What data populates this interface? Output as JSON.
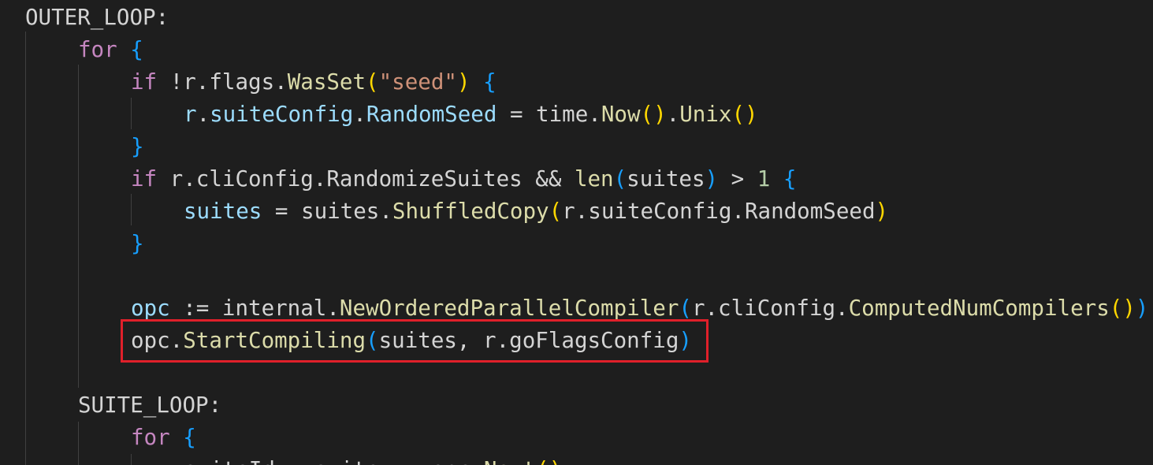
{
  "editor": {
    "background": "#1e1e1e",
    "highlight_color": "#e0202a",
    "highlighted_line": 10,
    "lines": [
      {
        "indent": 0,
        "tokens": [
          {
            "t": "OUTER_LOOP:",
            "c": "plain"
          }
        ]
      },
      {
        "indent": 1,
        "tokens": [
          {
            "t": "for",
            "c": "kw-ctrl"
          },
          {
            "t": " ",
            "c": "plain"
          },
          {
            "t": "{",
            "c": "b3"
          }
        ]
      },
      {
        "indent": 2,
        "tokens": [
          {
            "t": "if",
            "c": "kw-ctrl"
          },
          {
            "t": " !r.flags.",
            "c": "plain"
          },
          {
            "t": "WasSet",
            "c": "fn"
          },
          {
            "t": "(",
            "c": "b1"
          },
          {
            "t": "\"seed\"",
            "c": "str"
          },
          {
            "t": ")",
            "c": "b1"
          },
          {
            "t": " ",
            "c": "plain"
          },
          {
            "t": "{",
            "c": "b3"
          }
        ]
      },
      {
        "indent": 3,
        "tokens": [
          {
            "t": "r",
            "c": "var"
          },
          {
            "t": ".",
            "c": "plain"
          },
          {
            "t": "suiteConfig",
            "c": "var"
          },
          {
            "t": ".",
            "c": "plain"
          },
          {
            "t": "RandomSeed",
            "c": "var"
          },
          {
            "t": " = time.",
            "c": "plain"
          },
          {
            "t": "Now",
            "c": "fn"
          },
          {
            "t": "()",
            "c": "b1"
          },
          {
            "t": ".",
            "c": "plain"
          },
          {
            "t": "Unix",
            "c": "fn"
          },
          {
            "t": "()",
            "c": "b1"
          }
        ]
      },
      {
        "indent": 2,
        "tokens": [
          {
            "t": "}",
            "c": "b3"
          }
        ]
      },
      {
        "indent": 2,
        "tokens": [
          {
            "t": "if",
            "c": "kw-ctrl"
          },
          {
            "t": " r.cliConfig.RandomizeSuites && ",
            "c": "plain"
          },
          {
            "t": "len",
            "c": "fn"
          },
          {
            "t": "(",
            "c": "b3"
          },
          {
            "t": "suites",
            "c": "plain"
          },
          {
            "t": ")",
            "c": "b3"
          },
          {
            "t": " > ",
            "c": "plain"
          },
          {
            "t": "1",
            "c": "num"
          },
          {
            "t": " ",
            "c": "plain"
          },
          {
            "t": "{",
            "c": "b3"
          }
        ]
      },
      {
        "indent": 3,
        "tokens": [
          {
            "t": "suites",
            "c": "var"
          },
          {
            "t": " = suites.",
            "c": "plain"
          },
          {
            "t": "ShuffledCopy",
            "c": "fn"
          },
          {
            "t": "(",
            "c": "b1"
          },
          {
            "t": "r.suiteConfig.RandomSeed",
            "c": "plain"
          },
          {
            "t": ")",
            "c": "b1"
          }
        ]
      },
      {
        "indent": 2,
        "tokens": [
          {
            "t": "}",
            "c": "b3"
          }
        ]
      },
      {
        "indent": 2,
        "tokens": []
      },
      {
        "indent": 2,
        "tokens": [
          {
            "t": "opc",
            "c": "var"
          },
          {
            "t": " := internal.",
            "c": "plain"
          },
          {
            "t": "NewOrderedParallelCompiler",
            "c": "fn"
          },
          {
            "t": "(",
            "c": "b3"
          },
          {
            "t": "r.cliConfig.",
            "c": "plain"
          },
          {
            "t": "ComputedNumCompilers",
            "c": "fn"
          },
          {
            "t": "()",
            "c": "b1"
          },
          {
            "t": ")",
            "c": "b3"
          }
        ]
      },
      {
        "indent": 2,
        "tokens": [
          {
            "t": "opc.",
            "c": "plain"
          },
          {
            "t": "StartCompiling",
            "c": "fn"
          },
          {
            "t": "(",
            "c": "b3"
          },
          {
            "t": "suites, r.goFlagsConfig",
            "c": "plain"
          },
          {
            "t": ")",
            "c": "b3"
          }
        ]
      },
      {
        "indent": 1,
        "tokens": []
      },
      {
        "indent": 1,
        "tokens": [
          {
            "t": "SUITE_LOOP:",
            "c": "plain"
          }
        ]
      },
      {
        "indent": 2,
        "tokens": [
          {
            "t": "for",
            "c": "kw-ctrl"
          },
          {
            "t": " ",
            "c": "plain"
          },
          {
            "t": "{",
            "c": "b3"
          }
        ]
      },
      {
        "indent": 3,
        "tokens": [
          {
            "t": "suiteIdx, suite := opc.",
            "c": "plain"
          },
          {
            "t": "Next",
            "c": "fn"
          },
          {
            "t": "()",
            "c": "b1"
          }
        ]
      }
    ]
  }
}
